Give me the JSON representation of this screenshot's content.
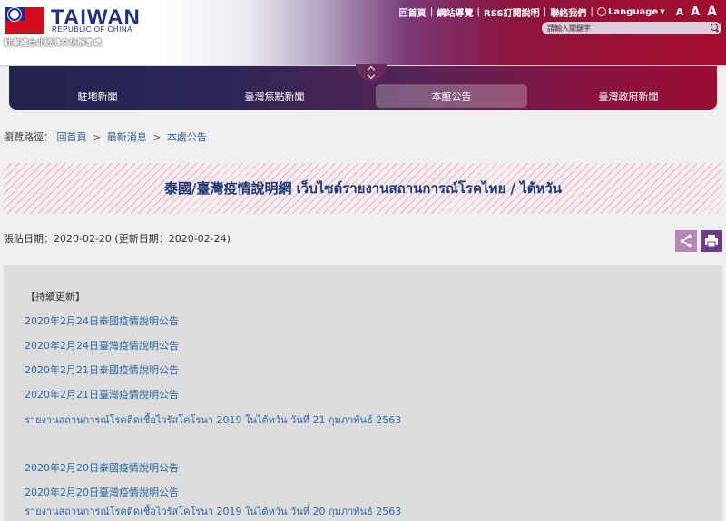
{
  "header": {
    "logo_main": "TAIWAN",
    "logo_sub": "REPUBLIC OF CHINA",
    "office_name": "駐泰國台北經濟文化辦事處",
    "toplinks": [
      "回首頁",
      "網站導覽",
      "RSS訂閱說明",
      "聯絡我們"
    ],
    "language_label": "Language",
    "font_sizes": [
      "A",
      "A",
      "A"
    ],
    "search_placeholder": "請輸入關鍵字"
  },
  "nav": {
    "items": [
      "駐地新聞",
      "臺灣焦點新聞",
      "本館公告",
      "臺灣政府新聞"
    ],
    "active_index": 2
  },
  "breadcrumb": {
    "prefix": "瀏覽路徑：",
    "items": [
      "回首頁",
      "最新消息",
      "本處公告"
    ],
    "separator": ">"
  },
  "article": {
    "title": "泰國/臺灣疫情說明網 เว็บไซต์รายงานสถานการณ์โรคไทย / ไต้หวัน",
    "dates": "張貼日期：2020-02-20 (更新日期：2020-02-24)",
    "note": "【持續更新】",
    "links": [
      "2020年2月24日泰國疫情說明公告",
      "2020年2月24日臺灣疫情說明公告",
      "2020年2月21日泰國疫情說明公告",
      "2020年2月21日臺灣疫情說明公告",
      "รายงานสถานการณ์โรคติดเชื้อไวรัสโคโรนา 2019 ในไต้หวัน วันที่ 21 กุมภาพันธ์ 2563",
      "2020年2月20日泰國疫情說明公告",
      "2020年2月20日臺灣疫情說明公告",
      "รายงานสถานการณ์โรคติดเชื้อไวรัสโคโรนา 2019 ในไต้หวัน วันที่ 20 กุมภาพันธ์ 2563"
    ]
  },
  "colors": {
    "nav_start": "#23234f",
    "nav_end": "#9c0d34",
    "link": "#2d6aa6",
    "title": "#1f3a7a",
    "share_button": "#b587b4",
    "print_button": "#6b3d82"
  }
}
